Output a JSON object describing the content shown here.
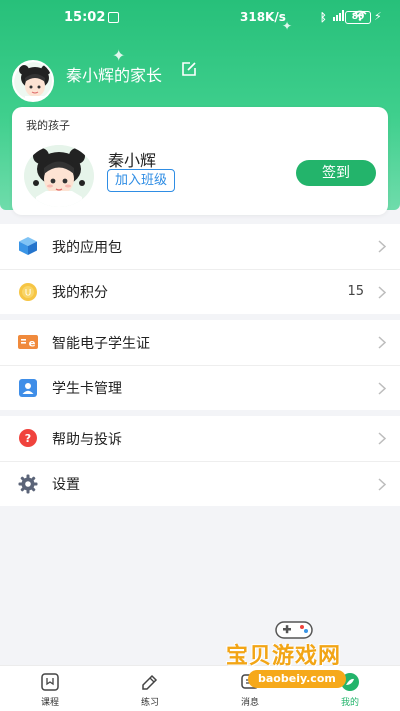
{
  "status_bar": {
    "time": "15:02",
    "network_speed": "318K/s",
    "signal_text": "4G",
    "battery": "80"
  },
  "header": {
    "parent_name": "秦小辉的家长",
    "colors": {
      "header_green": "#27c07a",
      "accent_blue": "#2f8de4",
      "button_green": "#23b46b"
    }
  },
  "kid_card": {
    "title": "我的孩子",
    "child_name": "秦小辉",
    "join_class_label": "加入班级",
    "checkin_label": "签到"
  },
  "menu": {
    "group1": [
      {
        "label": "我的应用包",
        "icon": "cube-icon"
      },
      {
        "label": "我的积分",
        "icon": "coin-icon",
        "value": "15"
      }
    ],
    "group2": [
      {
        "label": "智能电子学生证",
        "icon": "student-id-icon"
      },
      {
        "label": "学生卡管理",
        "icon": "card-manage-icon"
      }
    ],
    "group3": [
      {
        "label": "帮助与投诉",
        "icon": "help-icon"
      },
      {
        "label": "设置",
        "icon": "gear-icon"
      }
    ]
  },
  "tabbar": {
    "tabs": [
      {
        "label": "课程",
        "icon": "course-icon"
      },
      {
        "label": "练习",
        "icon": "practice-icon"
      },
      {
        "label": "消息",
        "icon": "message-icon"
      },
      {
        "label": "我的",
        "icon": "me-icon",
        "active": true
      }
    ]
  },
  "watermark": {
    "title": "宝贝游戏网",
    "url": "baobeiy.com"
  }
}
